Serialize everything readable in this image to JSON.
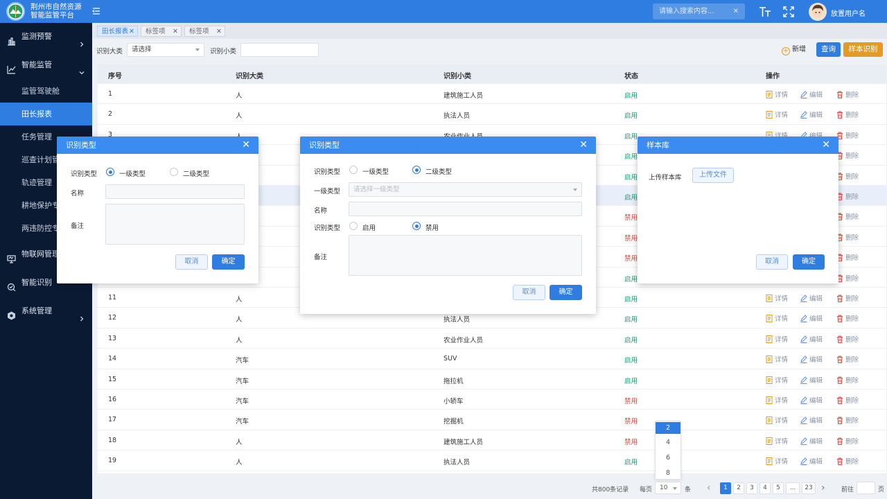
{
  "header": {
    "title_line1": "荆州市自然资源",
    "title_line2": "智能监管平台",
    "search_placeholder": "请输入搜索内容...",
    "search_clear": "✕",
    "username": "放置用户名"
  },
  "sidebar": {
    "items": [
      {
        "label": "监测预警",
        "icon": "monitor-icon"
      },
      {
        "label": "智能监管",
        "icon": "chart-line-icon"
      },
      {
        "label": "物联网管理",
        "icon": "iot-icon"
      },
      {
        "label": "智能识别",
        "icon": "recognition-icon"
      },
      {
        "label": "系统管理",
        "icon": "settings-icon"
      }
    ],
    "subitems": [
      "监管驾驶舱",
      "田长报表",
      "任务管理",
      "巡查计划管理",
      "轨迹管理",
      "耕地保护专题",
      "两违防控专题"
    ]
  },
  "tabs": [
    {
      "label": "田长报表",
      "close": "✕"
    },
    {
      "label": "标签项",
      "close": "✕"
    },
    {
      "label": "标签项",
      "close": "✕"
    }
  ],
  "filter": {
    "category_label": "识别大类",
    "category_placeholder": "请选择",
    "subcategory_label": "识别小类",
    "add_label": "新增",
    "add_icon_glyph": "+",
    "query_label": "查询",
    "sample_label": "样本识别"
  },
  "colors": {
    "primary": "#2f7de1",
    "enabled": "#1a9a72",
    "disabled": "#e0453c",
    "sample_button": "#e39b26",
    "sidebar": "#0b1a33"
  },
  "table": {
    "headers": [
      "序号",
      "识别大类",
      "识别小类",
      "状态",
      "操作"
    ],
    "ops": [
      "详情",
      "编辑",
      "删除"
    ],
    "rows": [
      {
        "no": "1",
        "cat": "人",
        "sub": "建筑施工人员",
        "status": "启用"
      },
      {
        "no": "2",
        "cat": "人",
        "sub": "执法人员",
        "status": "启用"
      },
      {
        "no": "3",
        "cat": "人",
        "sub": "农业作业人员",
        "status": "启用"
      },
      {
        "no": "",
        "cat": "",
        "sub": "",
        "status": "启用"
      },
      {
        "no": "",
        "cat": "",
        "sub": "",
        "status": "启用"
      },
      {
        "no": "",
        "cat": "",
        "sub": "",
        "status": "启用"
      },
      {
        "no": "",
        "cat": "",
        "sub": "",
        "status": "禁用"
      },
      {
        "no": "",
        "cat": "",
        "sub": "",
        "status": "禁用"
      },
      {
        "no": "",
        "cat": "",
        "sub": "",
        "status": "禁用"
      },
      {
        "no": "",
        "cat": "",
        "sub": "",
        "status": "启用"
      },
      {
        "no": "11",
        "cat": "人",
        "sub": "",
        "status": "启用"
      },
      {
        "no": "12",
        "cat": "人",
        "sub": "执法人员",
        "status": "启用"
      },
      {
        "no": "13",
        "cat": "人",
        "sub": "农业作业人员",
        "status": "启用"
      },
      {
        "no": "14",
        "cat": "汽车",
        "sub": "SUV",
        "status": "启用"
      },
      {
        "no": "15",
        "cat": "汽车",
        "sub": "拖拉机",
        "status": "启用"
      },
      {
        "no": "16",
        "cat": "汽车",
        "sub": "小轿车",
        "status": "禁用"
      },
      {
        "no": "17",
        "cat": "汽车",
        "sub": "挖掘机",
        "status": "禁用"
      },
      {
        "no": "18",
        "cat": "人",
        "sub": "建筑施工人员",
        "status": "禁用"
      },
      {
        "no": "19",
        "cat": "人",
        "sub": "执法人员",
        "status": "启用"
      }
    ]
  },
  "pagination": {
    "total": "共800条记录",
    "per_page_label": "每页",
    "per_page_value": "10",
    "per_page_unit": "条",
    "options": [
      "2",
      "4",
      "6",
      "8"
    ],
    "prev": "‹",
    "next": "›",
    "pages": [
      "1",
      "2",
      "3",
      "4",
      "5",
      "...",
      "23"
    ],
    "goto_label": "前往",
    "goto_unit": "页"
  },
  "modal1": {
    "title": "识别类型",
    "close": "✕",
    "type_label": "识别类型",
    "opt1": "一级类型",
    "opt2": "二级类型",
    "name_label": "名称",
    "remark_label": "备注",
    "cancel": "取消",
    "ok": "确定"
  },
  "modal2": {
    "title": "识别类型",
    "close": "✕",
    "type_label": "识别类型",
    "opt1": "一级类型",
    "opt2": "二级类型",
    "parent_label": "一级类型",
    "parent_placeholder": "请选择一级类型",
    "name_label": "名称",
    "status_label": "识别类型",
    "status_on": "启用",
    "status_off": "禁用",
    "remark_label": "备注",
    "cancel": "取消",
    "ok": "确定"
  },
  "modal3": {
    "title": "样本库",
    "close": "✕",
    "upload_label": "上传样本库",
    "upload_button": "上传文件",
    "cancel": "取消",
    "ok": "确定"
  }
}
